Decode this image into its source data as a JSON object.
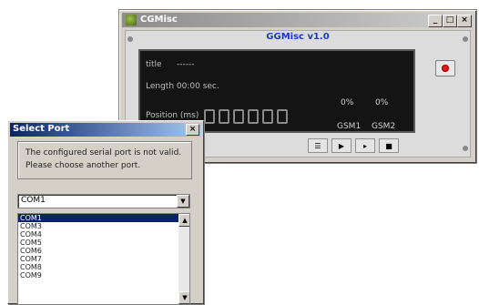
{
  "player": {
    "window_title": "CGMisc",
    "app_name": "GGMisc v1.0",
    "title_label": "title",
    "title_value": "------",
    "length_text": "Length  00:00 sec.",
    "position_label": "Position (ms)",
    "percent_1": "0%",
    "percent_2": "0%",
    "gsm_1": "GSM1",
    "gsm_2": "GSM2",
    "controls": [
      "playlist-icon",
      "play-icon",
      "step-icon",
      "stop-icon"
    ]
  },
  "dialog": {
    "title": "Select Port",
    "message_line_1": "The configured serial port is not valid.",
    "message_line_2": "Please choose another port.",
    "selected_value": "COM1",
    "list_items": [
      "COM1",
      "COM3",
      "COM4",
      "COM5",
      "COM6",
      "COM7",
      "COM8",
      "COM9"
    ],
    "selected_index": 0
  },
  "colors": {
    "accent_title": "#1a3cc8",
    "dialog_title_bar": "#0a246a",
    "record": "#e01818"
  }
}
